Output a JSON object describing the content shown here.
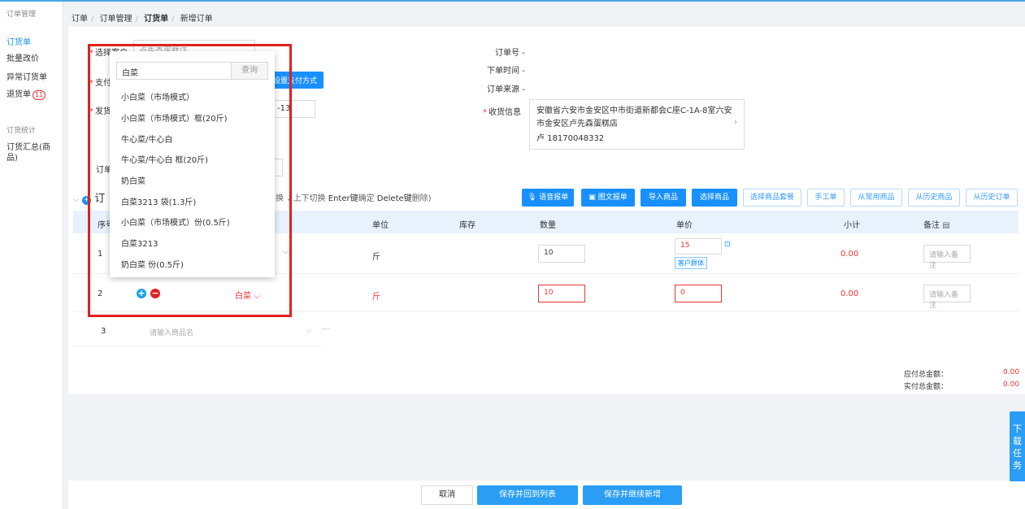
{
  "sidebar": {
    "group1": "订单管理",
    "items": [
      {
        "label": "订货单"
      },
      {
        "label": "批量改价"
      },
      {
        "label": "异常订货单"
      },
      {
        "label": "退货单",
        "badge": "11"
      }
    ],
    "group2": "订货统计",
    "items2": [
      {
        "label": "订货汇总(商品)"
      }
    ]
  },
  "breadcrumb": [
    "订单",
    "订单管理",
    "订货单",
    "新增订单"
  ],
  "form": {
    "store_label": "选择客户",
    "store_value": "卢先森蛋糕店",
    "pay_label": "支付",
    "pay_button": "设置支付方式",
    "delivery_label": "发货",
    "delivery_value": "-13",
    "order_label": "订单",
    "order_no_label": "订单号",
    "order_no_value": "-",
    "order_time_label": "下单时间",
    "order_time_value": "-",
    "order_source_label": "订单来源",
    "order_source_value": "-",
    "receive_label": "收货信息",
    "address_line1": "安徽省六安市金安区中市街道新都会C座C-1A-8室六安",
    "address_line2": "市金安区卢先森蛋糕店",
    "address_line3": "卢 18170048332"
  },
  "section": {
    "title": "订",
    "hint_switch": "换",
    "hint_updown": "上下切换",
    "hint_enter_key": "Enter键",
    "hint_enter_action": "确定",
    "hint_delete_key": "Delete键",
    "hint_delete_action": "删除)"
  },
  "toolbar": {
    "voice": "语音报单",
    "image": "图文报单",
    "import": "导入商品",
    "select_goods": "选择商品",
    "select_package": "选择商品套餐",
    "manual": "手工单",
    "common": "从常用商品",
    "history_goods": "从历史商品",
    "history_order": "从历史订单"
  },
  "table": {
    "headers": {
      "seq": "序号",
      "unit": "单位",
      "stock": "库存",
      "qty": "数量",
      "price": "单价",
      "subtotal": "小计",
      "remark": "备注"
    },
    "rows": [
      {
        "seq": "1",
        "unit": "斤",
        "qty": "10",
        "price": "15",
        "price_tag": "客户群体",
        "subtotal": "0.00",
        "remark_placeholder": "请输入备注"
      },
      {
        "seq": "2",
        "name": "白菜",
        "unit": "斤",
        "qty": "10",
        "price": "0",
        "subtotal": "0.00",
        "remark_placeholder": "请输入备注"
      },
      {
        "seq": "3",
        "name_placeholder": "请输入商品名",
        "more": "···"
      }
    ]
  },
  "totals": {
    "payable_label": "应付总金额：",
    "payable_value": "0.00",
    "actual_label": "实付总金额：",
    "actual_value": "0.00"
  },
  "dropdown": {
    "search_value": "白菜",
    "search_button": "查询",
    "items": [
      "小白菜（市场模式）",
      "小白菜（市场模式）框(20斤)",
      "牛心菜/牛心白",
      "牛心菜/牛心白 框(20斤)",
      "奶白菜",
      "白菜3213 袋(1.3斤)",
      "小白菜（市场模式）份(0.5斤)",
      "白菜3213",
      "奶白菜 份(0.5斤)"
    ]
  },
  "footer": {
    "cancel": "取消",
    "save_return": "保存并回到列表",
    "save_continue": "保存并继续新增"
  },
  "download_task": "下载任务",
  "colors": {
    "primary": "#1890ff",
    "danger": "#e33",
    "highlight_box": "#e02020"
  }
}
